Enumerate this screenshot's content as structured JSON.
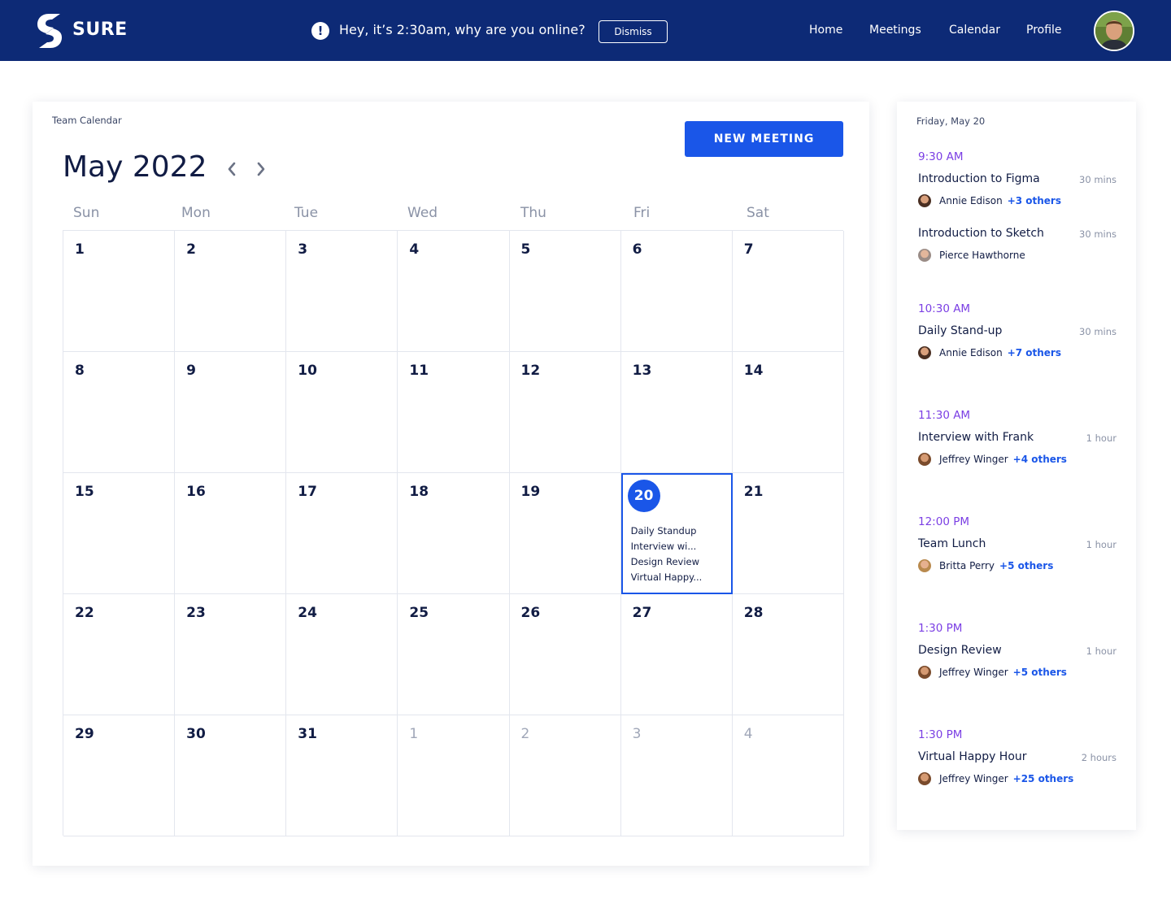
{
  "header": {
    "brand": "SURE",
    "alert_text": "Hey, it’s 2:30am, why are you online?",
    "dismiss_label": "Dismiss",
    "nav": [
      "Home",
      "Meetings",
      "Calendar",
      "Profile"
    ]
  },
  "calendar": {
    "card_label": "Team Calendar",
    "month_title": "May 2022",
    "new_meeting_label": "NEW MEETING",
    "weekdays": [
      "Sun",
      "Mon",
      "Tue",
      "Wed",
      "Thu",
      "Fri",
      "Sat"
    ],
    "days": [
      "1",
      "2",
      "3",
      "4",
      "5",
      "6",
      "7",
      "8",
      "9",
      "10",
      "11",
      "12",
      "13",
      "14",
      "15",
      "16",
      "17",
      "18",
      "19",
      "20",
      "21",
      "22",
      "23",
      "24",
      "25",
      "26",
      "27",
      "28",
      "29",
      "30",
      "31",
      "1",
      "2",
      "3",
      "4"
    ],
    "today_events": [
      "Daily Standup",
      "Interview wi...",
      "Design Review",
      "Virtual Happy..."
    ]
  },
  "agenda": {
    "date": "Friday, May 20",
    "groups": [
      {
        "time": "9:30 AM",
        "meetings": [
          {
            "title": "Introduction to Figma",
            "duration": "30 mins",
            "attendee": "Annie Edison",
            "others": "+3 others"
          },
          {
            "title": "Introduction to Sketch",
            "duration": "30 mins",
            "attendee": "Pierce Hawthorne",
            "others": ""
          }
        ]
      },
      {
        "time": "10:30 AM",
        "meetings": [
          {
            "title": "Daily Stand-up",
            "duration": "30 mins",
            "attendee": "Annie Edison",
            "others": "+7 others"
          }
        ]
      },
      {
        "time": "11:30 AM",
        "meetings": [
          {
            "title": "Interview with Frank",
            "duration": "1 hour",
            "attendee": "Jeffrey Winger",
            "others": "+4 others"
          }
        ]
      },
      {
        "time": "12:00 PM",
        "meetings": [
          {
            "title": "Team Lunch",
            "duration": "1 hour",
            "attendee": "Britta Perry",
            "others": "+5 others"
          }
        ]
      },
      {
        "time": "1:30 PM",
        "meetings": [
          {
            "title": "Design Review",
            "duration": "1 hour",
            "attendee": "Jeffrey Winger",
            "others": "+5 others"
          }
        ]
      },
      {
        "time": "1:30 PM",
        "meetings": [
          {
            "title": "Virtual Happy Hour",
            "duration": "2 hours",
            "attendee": "Jeffrey Winger",
            "others": "+25 others"
          }
        ]
      }
    ]
  },
  "colors": {
    "header_bg": "#0d2a76",
    "accent": "#1a56e8",
    "time_label": "#7b3fe4"
  }
}
